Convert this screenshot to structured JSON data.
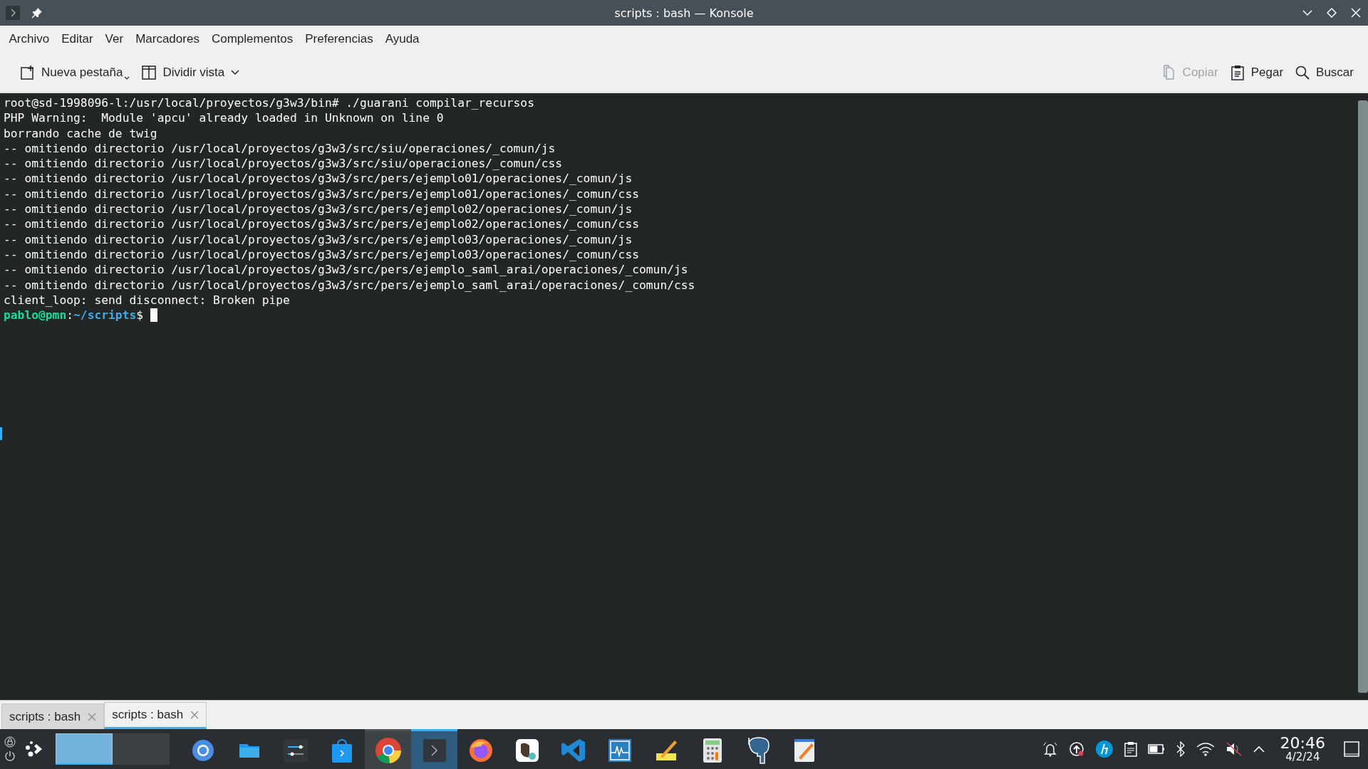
{
  "window": {
    "title": "scripts : bash — Konsole"
  },
  "menu": [
    "Archivo",
    "Editar",
    "Ver",
    "Marcadores",
    "Complementos",
    "Preferencias",
    "Ayuda"
  ],
  "toolbar": {
    "left": [
      {
        "kind": "new-tab",
        "label": "Nueva pestaña",
        "disabled": false
      },
      {
        "kind": "split",
        "label": "Dividir vista",
        "disabled": false
      }
    ],
    "right": [
      {
        "kind": "copy",
        "label": "Copiar",
        "disabled": true
      },
      {
        "kind": "paste",
        "label": "Pegar",
        "disabled": false
      },
      {
        "kind": "search",
        "label": "Buscar",
        "disabled": false
      }
    ]
  },
  "terminal": {
    "lines": [
      {
        "kind": "output",
        "text": "root@sd-1998096-l:/usr/local/proyectos/g3w3/bin# ./guarani compilar_recursos"
      },
      {
        "kind": "output",
        "text": "PHP Warning:  Module 'apcu' already loaded in Unknown on line 0"
      },
      {
        "kind": "output",
        "text": "borrando cache de twig"
      },
      {
        "kind": "output",
        "text": "-- omitiendo directorio /usr/local/proyectos/g3w3/src/siu/operaciones/_comun/js"
      },
      {
        "kind": "output",
        "text": "-- omitiendo directorio /usr/local/proyectos/g3w3/src/siu/operaciones/_comun/css"
      },
      {
        "kind": "output",
        "text": "-- omitiendo directorio /usr/local/proyectos/g3w3/src/pers/ejemplo01/operaciones/_comun/js"
      },
      {
        "kind": "output",
        "text": "-- omitiendo directorio /usr/local/proyectos/g3w3/src/pers/ejemplo01/operaciones/_comun/css"
      },
      {
        "kind": "output",
        "text": "-- omitiendo directorio /usr/local/proyectos/g3w3/src/pers/ejemplo02/operaciones/_comun/js"
      },
      {
        "kind": "output",
        "text": "-- omitiendo directorio /usr/local/proyectos/g3w3/src/pers/ejemplo02/operaciones/_comun/css"
      },
      {
        "kind": "output",
        "text": "-- omitiendo directorio /usr/local/proyectos/g3w3/src/pers/ejemplo03/operaciones/_comun/js"
      },
      {
        "kind": "output",
        "text": "-- omitiendo directorio /usr/local/proyectos/g3w3/src/pers/ejemplo03/operaciones/_comun/css"
      },
      {
        "kind": "output",
        "text": "-- omitiendo directorio /usr/local/proyectos/g3w3/src/pers/ejemplo_saml_arai/operaciones/_comun/js"
      },
      {
        "kind": "output",
        "text": "-- omitiendo directorio /usr/local/proyectos/g3w3/src/pers/ejemplo_saml_arai/operaciones/_comun/css"
      },
      {
        "kind": "output",
        "text": "client_loop: send disconnect: Broken pipe"
      },
      {
        "kind": "prompt",
        "user": "pablo@pmn",
        "separator": ":",
        "path": "~/scripts",
        "symbol": "$",
        "cursor": true
      }
    ]
  },
  "tabs": [
    {
      "label": "scripts : bash",
      "selected": false
    },
    {
      "label": "scripts : bash",
      "selected": true
    }
  ],
  "taskbar": {
    "desktops": [
      {
        "selected": true
      },
      {
        "selected": false
      }
    ],
    "apps": [
      {
        "kind": "chromium",
        "active": false,
        "hovered": false
      },
      {
        "kind": "files",
        "active": false,
        "hovered": false
      },
      {
        "kind": "settings",
        "active": false,
        "hovered": false
      },
      {
        "kind": "store",
        "active": false,
        "hovered": false
      },
      {
        "kind": "chrome",
        "active": false,
        "hovered": true
      },
      {
        "kind": "terminal",
        "active": true,
        "hovered": false
      },
      {
        "kind": "firefox",
        "active": false,
        "hovered": false
      },
      {
        "kind": "dbeaver",
        "active": false,
        "hovered": false
      },
      {
        "kind": "vscode",
        "active": false,
        "hovered": false
      },
      {
        "kind": "monitor",
        "active": false,
        "hovered": false
      },
      {
        "kind": "notes",
        "active": false,
        "hovered": false
      },
      {
        "kind": "calculator",
        "active": false,
        "hovered": false
      },
      {
        "kind": "postgres",
        "active": false,
        "hovered": false
      },
      {
        "kind": "editor",
        "active": false,
        "hovered": false
      }
    ],
    "tray": [
      {
        "kind": "alarm"
      },
      {
        "kind": "updates"
      },
      {
        "kind": "hp"
      },
      {
        "kind": "clipboard"
      },
      {
        "kind": "battery"
      },
      {
        "kind": "bluetooth"
      },
      {
        "kind": "wifi"
      },
      {
        "kind": "muted"
      },
      {
        "kind": "expand"
      }
    ],
    "clock": {
      "time": "20:46",
      "date": "4/2/24"
    }
  }
}
